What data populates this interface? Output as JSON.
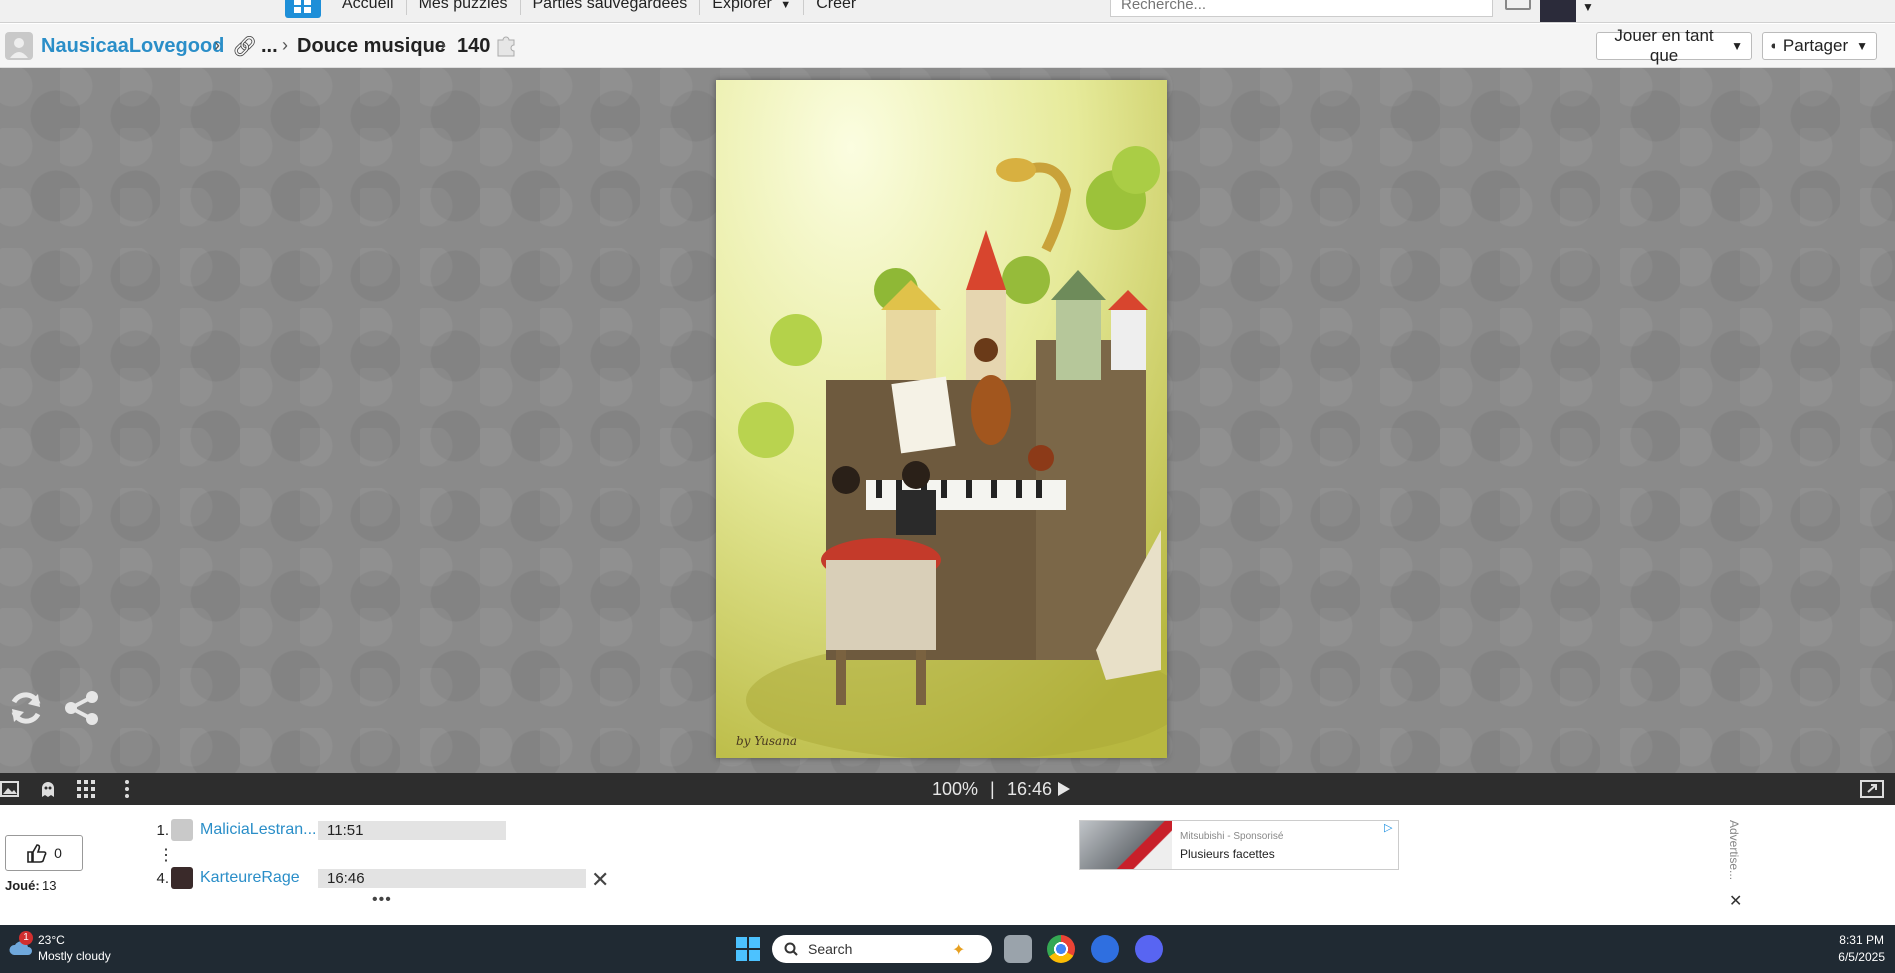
{
  "topnav": {
    "links": [
      "Accueil",
      "Mes puzzles",
      "Parties sauvegardées",
      "Explorer",
      "Créer"
    ],
    "search_placeholder": "Recherche..."
  },
  "breadcrumb": {
    "user": "NausicaaLovegood",
    "more": "...",
    "title": "Douce musique",
    "pieces": "140"
  },
  "header_buttons": {
    "play_as": "Jouer en tant que",
    "share": "Partager"
  },
  "status": {
    "zoom": "100%",
    "divider": "|",
    "time": "16:46"
  },
  "stats": {
    "likes": "0",
    "played_label": "Joué:",
    "played_count": "13"
  },
  "leaderboard": [
    {
      "rank": "1.",
      "name": "MaliciaLestran...",
      "time": "11:51"
    },
    {
      "rank": "4.",
      "name": "KarteureRage",
      "time": "16:46"
    }
  ],
  "leaderboard_more": "•••",
  "ad": {
    "sponsor": "Mitsubishi - Sponsorisé",
    "title": "Plusieurs facettes",
    "advertise": "Advertise..."
  },
  "taskbar": {
    "weather_temp": "23°C",
    "weather_desc": "Mostly cloudy",
    "weather_badge": "1",
    "search_label": "Search",
    "clock_time": "8:31 PM",
    "clock_date": "6/5/2025"
  },
  "colors": {
    "link": "#2a8ec8",
    "toolbar": "#2d2d2d",
    "stage": "#8a8a8a",
    "taskbar": "#202a33"
  }
}
